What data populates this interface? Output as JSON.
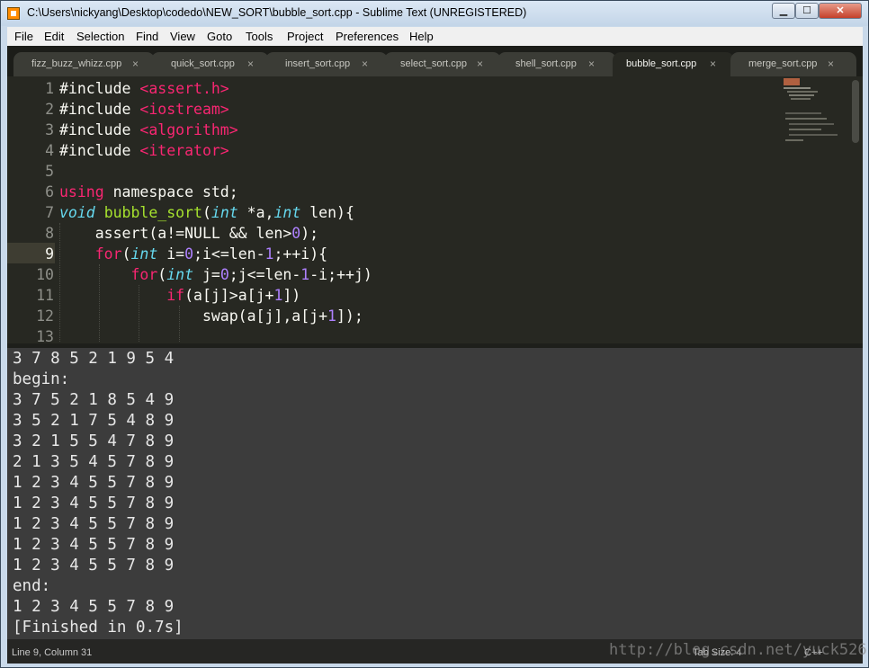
{
  "window": {
    "title": "C:\\Users\\nickyang\\Desktop\\codedo\\NEW_SORT\\bubble_sort.cpp - Sublime Text (UNREGISTERED)",
    "buttons": {
      "minimize": "▁",
      "maximize": "☐",
      "close": "✕"
    }
  },
  "menu": [
    "File",
    "Edit",
    "Selection",
    "Find",
    "View",
    "Goto",
    "Tools",
    "Project",
    "Preferences",
    "Help"
  ],
  "tabs": [
    {
      "label": "fizz_buzz_whizz.cpp",
      "active": false
    },
    {
      "label": "quick_sort.cpp",
      "active": false
    },
    {
      "label": "insert_sort.cpp",
      "active": false
    },
    {
      "label": "select_sort.cpp",
      "active": false
    },
    {
      "label": "shell_sort.cpp",
      "active": false
    },
    {
      "label": "bubble_sort.cpp",
      "active": true
    },
    {
      "label": "merge_sort.cpp",
      "active": false
    }
  ],
  "tab_close_glyph": "×",
  "editor": {
    "line_numbers": [
      "1",
      "2",
      "3",
      "4",
      "5",
      "6",
      "7",
      "8",
      "9",
      "10",
      "11",
      "12",
      "13"
    ],
    "current_line": 9,
    "code_lines": [
      [
        {
          "t": "#include ",
          "c": ""
        },
        {
          "t": "<assert.h>",
          "c": "kw"
        }
      ],
      [
        {
          "t": "#include ",
          "c": ""
        },
        {
          "t": "<iostream>",
          "c": "kw"
        }
      ],
      [
        {
          "t": "#include ",
          "c": ""
        },
        {
          "t": "<algorithm>",
          "c": "kw"
        }
      ],
      [
        {
          "t": "#include ",
          "c": ""
        },
        {
          "t": "<iterator>",
          "c": "kw"
        }
      ],
      [],
      [
        {
          "t": "using",
          "c": "kw"
        },
        {
          "t": " namespace std;",
          "c": ""
        }
      ],
      [
        {
          "t": "void",
          "c": "type"
        },
        {
          "t": " ",
          "c": ""
        },
        {
          "t": "bubble_sort",
          "c": "fn"
        },
        {
          "t": "(",
          "c": ""
        },
        {
          "t": "int",
          "c": "type"
        },
        {
          "t": " *a,",
          "c": ""
        },
        {
          "t": "int",
          "c": "type"
        },
        {
          "t": " len){",
          "c": ""
        }
      ],
      [
        {
          "t": "    assert(a!=NULL && len>",
          "c": ""
        },
        {
          "t": "0",
          "c": "num"
        },
        {
          "t": ");",
          "c": ""
        }
      ],
      [
        {
          "t": "    ",
          "c": ""
        },
        {
          "t": "for",
          "c": "kw"
        },
        {
          "t": "(",
          "c": ""
        },
        {
          "t": "int",
          "c": "type"
        },
        {
          "t": " i=",
          "c": ""
        },
        {
          "t": "0",
          "c": "num"
        },
        {
          "t": ";i<=len-",
          "c": ""
        },
        {
          "t": "1",
          "c": "num"
        },
        {
          "t": ";++i){",
          "c": ""
        }
      ],
      [
        {
          "t": "        ",
          "c": ""
        },
        {
          "t": "for",
          "c": "kw"
        },
        {
          "t": "(",
          "c": ""
        },
        {
          "t": "int",
          "c": "type"
        },
        {
          "t": " j=",
          "c": ""
        },
        {
          "t": "0",
          "c": "num"
        },
        {
          "t": ";j<=len-",
          "c": ""
        },
        {
          "t": "1",
          "c": "num"
        },
        {
          "t": "-i;++j)",
          "c": ""
        }
      ],
      [
        {
          "t": "            ",
          "c": ""
        },
        {
          "t": "if",
          "c": "kw"
        },
        {
          "t": "(a[j]>a[j+",
          "c": ""
        },
        {
          "t": "1",
          "c": "num"
        },
        {
          "t": "])",
          "c": ""
        }
      ],
      [
        {
          "t": "                swap(a[j],a[j+",
          "c": ""
        },
        {
          "t": "1",
          "c": "num"
        },
        {
          "t": "]);",
          "c": ""
        }
      ],
      []
    ]
  },
  "output": {
    "lines": [
      "3 7 8 5 2 1 9 5 4",
      "begin:",
      "3 7 5 2 1 8 5 4 9",
      "3 5 2 1 7 5 4 8 9",
      "3 2 1 5 5 4 7 8 9",
      "2 1 3 5 4 5 7 8 9",
      "1 2 3 4 5 5 7 8 9",
      "1 2 3 4 5 5 7 8 9",
      "1 2 3 4 5 5 7 8 9",
      "1 2 3 4 5 5 7 8 9",
      "1 2 3 4 5 5 7 8 9",
      "end:",
      "1 2 3 4 5 5 7 8 9",
      "[Finished in 0.7s]"
    ]
  },
  "status": {
    "position": "Line 9, Column 31",
    "tab_size": "Tab Size: 4",
    "syntax": "C++"
  },
  "watermark": "http://blog.csdn.net/yuck526",
  "colors": {
    "editor_bg": "#272822",
    "output_bg": "#3c3c3c",
    "keyword": "#f92672",
    "type": "#66d9ef",
    "function": "#a6e22e",
    "number": "#ae81ff"
  }
}
